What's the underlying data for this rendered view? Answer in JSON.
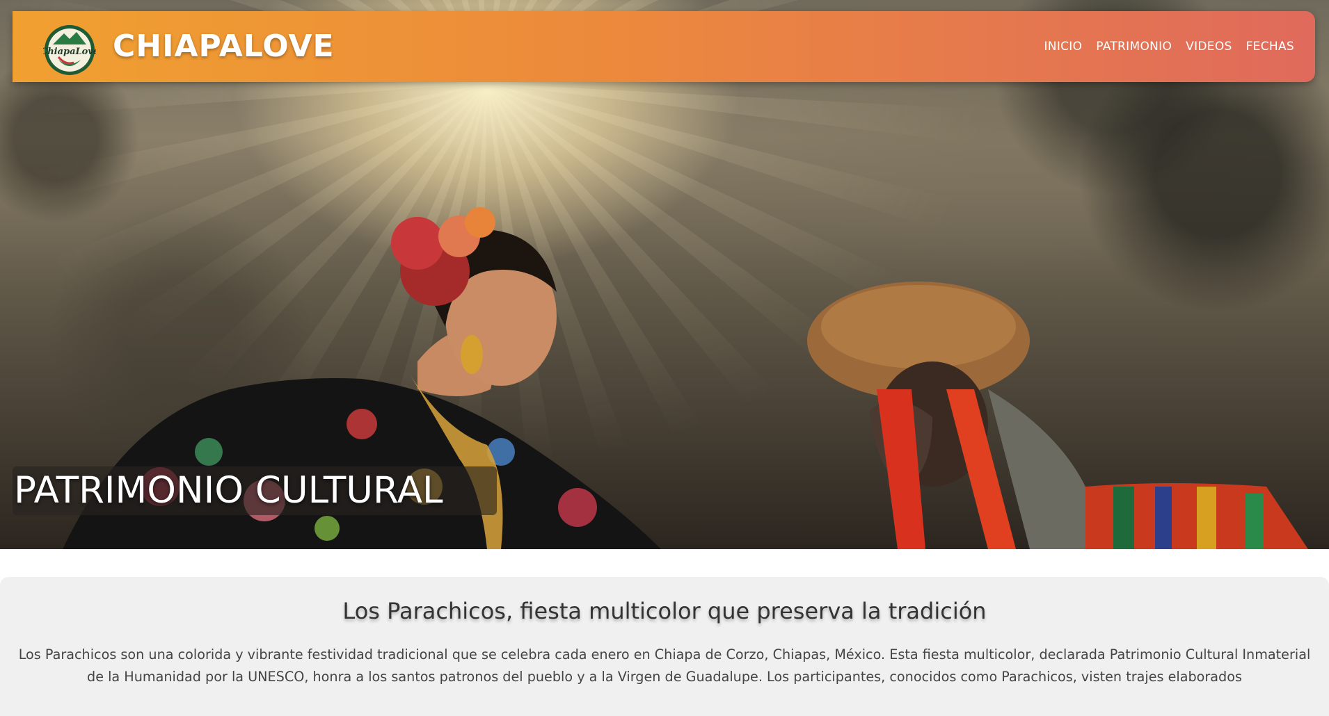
{
  "navbar": {
    "logo_text": "ChiapaLove",
    "brand": "CHIAPALOVE",
    "links": [
      "INICIO",
      "PATRIMONIO",
      "VIDEOS",
      "FECHAS"
    ],
    "gradient": [
      "#f0a030",
      "#e06a5c"
    ]
  },
  "hero": {
    "title": "PATRIMONIO CULTURAL"
  },
  "article": {
    "heading": "Los Parachicos, fiesta multicolor que preserva la tradición",
    "body": "Los Parachicos son una colorida y vibrante festividad tradicional que se celebra cada enero en Chiapa de Corzo, Chiapas, México. Esta fiesta multicolor, declarada Patrimonio Cultural Inmaterial de la Humanidad por la UNESCO, honra a los santos patronos del pueblo y a la Virgen de Guadalupe. Los participantes, conocidos como Parachicos, visten trajes elaborados"
  }
}
